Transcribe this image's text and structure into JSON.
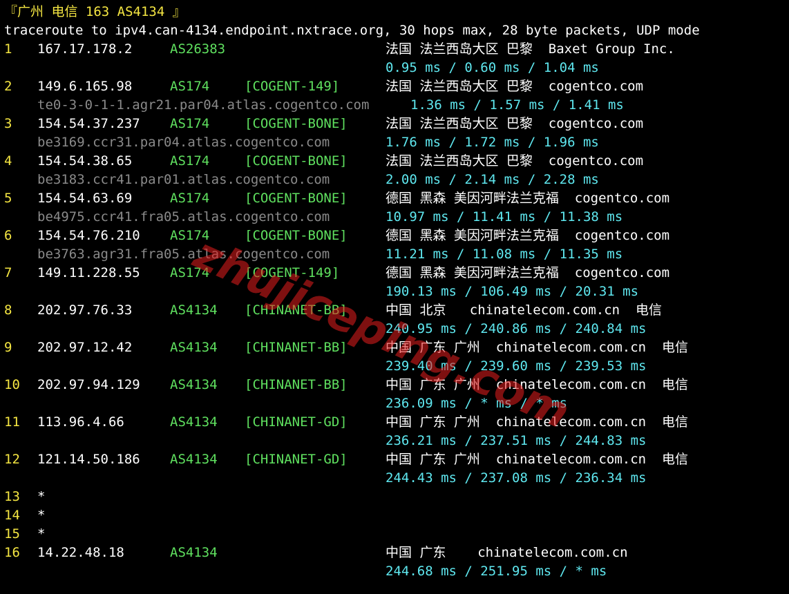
{
  "title": "『广州 电信 163 AS4134 』",
  "command": "traceroute to ipv4.can-4134.endpoint.nxtrace.org, 30 hops max, 28 byte packets, UDP mode",
  "hops": [
    {
      "n": "1",
      "ip": "167.17.178.2",
      "asn": "AS26383",
      "tag": "",
      "geo": "法国 法兰西岛大区 巴黎  Baxet Group Inc.",
      "host": "",
      "rtt": "0.95 ms / 0.60 ms / 1.04 ms"
    },
    {
      "n": "2",
      "ip": "149.6.165.98",
      "asn": "AS174",
      "tag": "[COGENT-149]",
      "geo": "法国 法兰西岛大区 巴黎  cogentco.com",
      "host": "te0-3-0-1-1.agr21.par04.atlas.cogentco.com",
      "rtt": "1.36 ms / 1.57 ms / 1.41 ms"
    },
    {
      "n": "3",
      "ip": "154.54.37.237",
      "asn": "AS174",
      "tag": "[COGENT-BONE]",
      "geo": "法国 法兰西岛大区 巴黎  cogentco.com",
      "host": "be3169.ccr31.par04.atlas.cogentco.com",
      "rtt": "1.76 ms / 1.72 ms / 1.96 ms"
    },
    {
      "n": "4",
      "ip": "154.54.38.65",
      "asn": "AS174",
      "tag": "[COGENT-BONE]",
      "geo": "法国 法兰西岛大区 巴黎  cogentco.com",
      "host": "be3183.ccr41.par01.atlas.cogentco.com",
      "rtt": "2.00 ms / 2.14 ms / 2.28 ms"
    },
    {
      "n": "5",
      "ip": "154.54.63.69",
      "asn": "AS174",
      "tag": "[COGENT-BONE]",
      "geo": "德国 黑森 美因河畔法兰克福  cogentco.com",
      "host": "be4975.ccr41.fra05.atlas.cogentco.com",
      "rtt": "10.97 ms / 11.41 ms / 11.38 ms"
    },
    {
      "n": "6",
      "ip": "154.54.76.210",
      "asn": "AS174",
      "tag": "[COGENT-BONE]",
      "geo": "德国 黑森 美因河畔法兰克福  cogentco.com",
      "host": "be3763.agr31.fra05.atlas.cogentco.com",
      "rtt": "11.21 ms / 11.08 ms / 11.35 ms"
    },
    {
      "n": "7",
      "ip": "149.11.228.55",
      "asn": "AS174",
      "tag": "[COGENT-149]",
      "geo": "德国 黑森 美因河畔法兰克福  cogentco.com",
      "host": "",
      "rtt": "190.13 ms / 106.49 ms / 20.31 ms"
    },
    {
      "n": "8",
      "ip": "202.97.76.33",
      "asn": "AS4134",
      "tag": "[CHINANET-BB]",
      "geo": "中国 北京   chinatelecom.com.cn  电信",
      "host": "",
      "rtt": "240.95 ms / 240.86 ms / 240.84 ms"
    },
    {
      "n": "9",
      "ip": "202.97.12.42",
      "asn": "AS4134",
      "tag": "[CHINANET-BB]",
      "geo": "中国 广东 广州  chinatelecom.com.cn  电信",
      "host": "",
      "rtt": "239.40 ms / 239.60 ms / 239.53 ms"
    },
    {
      "n": "10",
      "ip": "202.97.94.129",
      "asn": "AS4134",
      "tag": "[CHINANET-BB]",
      "geo": "中国 广东 广州  chinatelecom.com.cn  电信",
      "host": "",
      "rtt": "236.09 ms / * ms / * ms"
    },
    {
      "n": "11",
      "ip": "113.96.4.66",
      "asn": "AS4134",
      "tag": "[CHINANET-GD]",
      "geo": "中国 广东 广州  chinatelecom.com.cn  电信",
      "host": "",
      "rtt": "236.21 ms / 237.51 ms / 244.83 ms"
    },
    {
      "n": "12",
      "ip": "121.14.50.186",
      "asn": "AS4134",
      "tag": "[CHINANET-GD]",
      "geo": "中国 广东 广州  chinatelecom.com.cn  电信",
      "host": "",
      "rtt": "244.43 ms / 237.08 ms / 236.34 ms"
    },
    {
      "n": "13",
      "ip": "*",
      "asn": "",
      "tag": "",
      "geo": "",
      "host": "",
      "rtt": ""
    },
    {
      "n": "14",
      "ip": "*",
      "asn": "",
      "tag": "",
      "geo": "",
      "host": "",
      "rtt": ""
    },
    {
      "n": "15",
      "ip": "*",
      "asn": "",
      "tag": "",
      "geo": "",
      "host": "",
      "rtt": ""
    },
    {
      "n": "16",
      "ip": "14.22.48.18",
      "asn": "AS4134",
      "tag": "",
      "geo": "中国 广东    chinatelecom.com.cn",
      "host": "",
      "rtt": "244.68 ms / 251.95 ms / * ms"
    }
  ],
  "watermark": "zhujiceping.com",
  "colors": {
    "hop": "#f5e642",
    "asn": "#5fe05f",
    "rtt": "#5fe8f0",
    "host": "#8a8a8a",
    "watermark": "#e61e1e"
  }
}
